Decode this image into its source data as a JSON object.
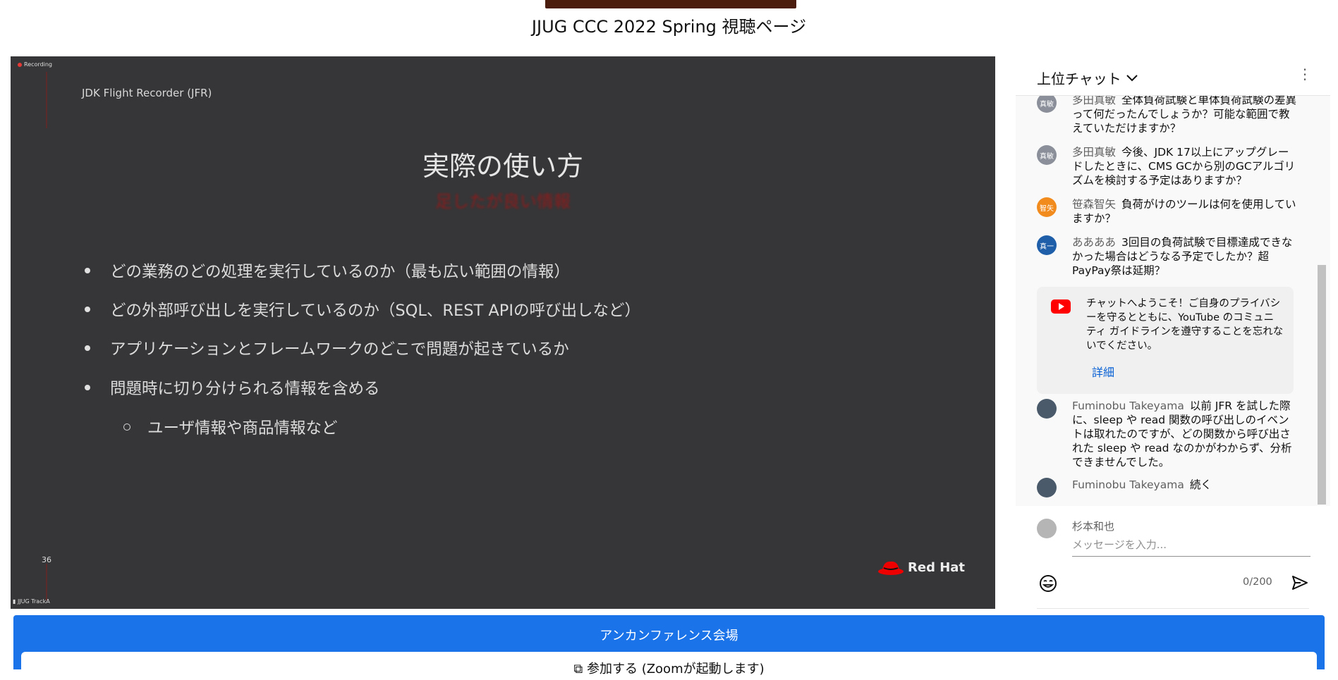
{
  "page": {
    "title": "JJUG CCC 2022 Spring 視聴ページ"
  },
  "video": {
    "recording_label": "Recording",
    "slide_header": "JDK Flight Recorder (JFR)",
    "slide_title": "実際の使い方",
    "slide_subtitle": "足したが良い情報",
    "bullets": [
      "どの業務のどの処理を実行しているのか（最も広い範囲の情報）",
      "どの外部呼び出しを実行しているのか（SQL、REST APIの呼び出しなど）",
      "アプリケーションとフレームワークのどこで問題が起きているか",
      "問題時に切り分けられる情報を含める"
    ],
    "sub_bullet": "ユーザ情報や商品情報など",
    "page_number": "36",
    "brand": "Red Hat",
    "track_label": "JJUG TrackA"
  },
  "chat": {
    "title": "上位チャット",
    "messages": [
      {
        "author": "多田真敏",
        "avatar": "真敏",
        "avatar_color": "#8a8f99",
        "text": "全体負荷試験と単体負荷試験の差異って何だったんでしょうか？可能な範囲で教えていただけますか？"
      },
      {
        "author": "多田真敏",
        "avatar": "真敏",
        "avatar_color": "#8a8f99",
        "text": "今後、JDK 17以上にアップグレードしたときに、CMS GCから別のGCアルゴリズムを検討する予定はありますか？"
      },
      {
        "author": "笹森智矢",
        "avatar": "智矢",
        "avatar_color": "#f28b1e",
        "text": "負荷がけのツールは何を使用していますか？"
      },
      {
        "author": "ああああ",
        "avatar": "真一",
        "avatar_color": "#1f5fa9",
        "text": "3回目の負荷試験で目標達成できなかった場合はどうなる予定でしたか？超PayPay祭は延期？"
      },
      {
        "author": "Fuminobu Takeyama",
        "avatar": "",
        "avatar_color": "#4a5a6a",
        "text": "以前 JFR を試した際に、sleep や read 関数の呼び出しのイベントは取れたのですが、どの関数から呼び出された sleep や read なのかがわからず、分析できませんでした。"
      },
      {
        "author": "Fuminobu Takeyama",
        "avatar": "",
        "avatar_color": "#4a5a6a",
        "text": "続く"
      }
    ],
    "welcome": {
      "text": "チャットへようこそ！ご自身のプライバシーを守るとともに、YouTube のコミュニティ ガイドラインを遵守することを忘れないでください。",
      "link": "詳細"
    },
    "input": {
      "user": "杉本和也",
      "placeholder": "メッセージを入力...",
      "counter": "0/200"
    }
  },
  "unconference": {
    "title": "アンカンファレンス会場",
    "join_label": "参加する (Zoomが起動します)"
  }
}
